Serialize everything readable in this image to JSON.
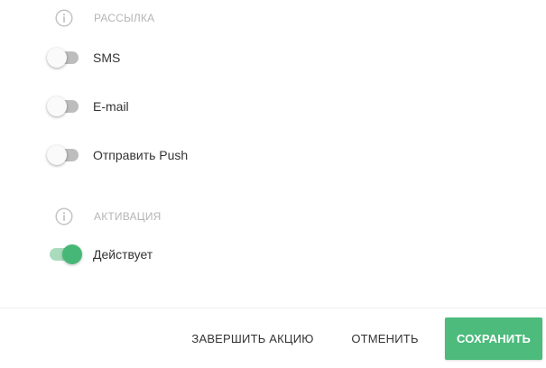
{
  "sections": {
    "mailing": {
      "title": "РАССЫЛКА",
      "icon": "info-icon",
      "toggles": [
        {
          "label": "SMS",
          "on": false
        },
        {
          "label": "E-mail",
          "on": false
        },
        {
          "label": "Отправить Push",
          "on": false
        }
      ]
    },
    "activation": {
      "title": "АКТИВАЦИЯ",
      "icon": "info-icon",
      "toggles": [
        {
          "label": "Действует",
          "on": true
        }
      ]
    }
  },
  "footer": {
    "finish_label": "ЗАВЕРШИТЬ АКЦИЮ",
    "cancel_label": "ОТМЕНИТЬ",
    "save_label": "СОХРАНИТЬ"
  },
  "colors": {
    "accent": "#4cbb7c",
    "toggle_on_thumb": "#47b777",
    "toggle_on_track": "#a8dcbc",
    "toggle_off_track": "#bdbdbd",
    "section_title": "#b5b5b5"
  }
}
